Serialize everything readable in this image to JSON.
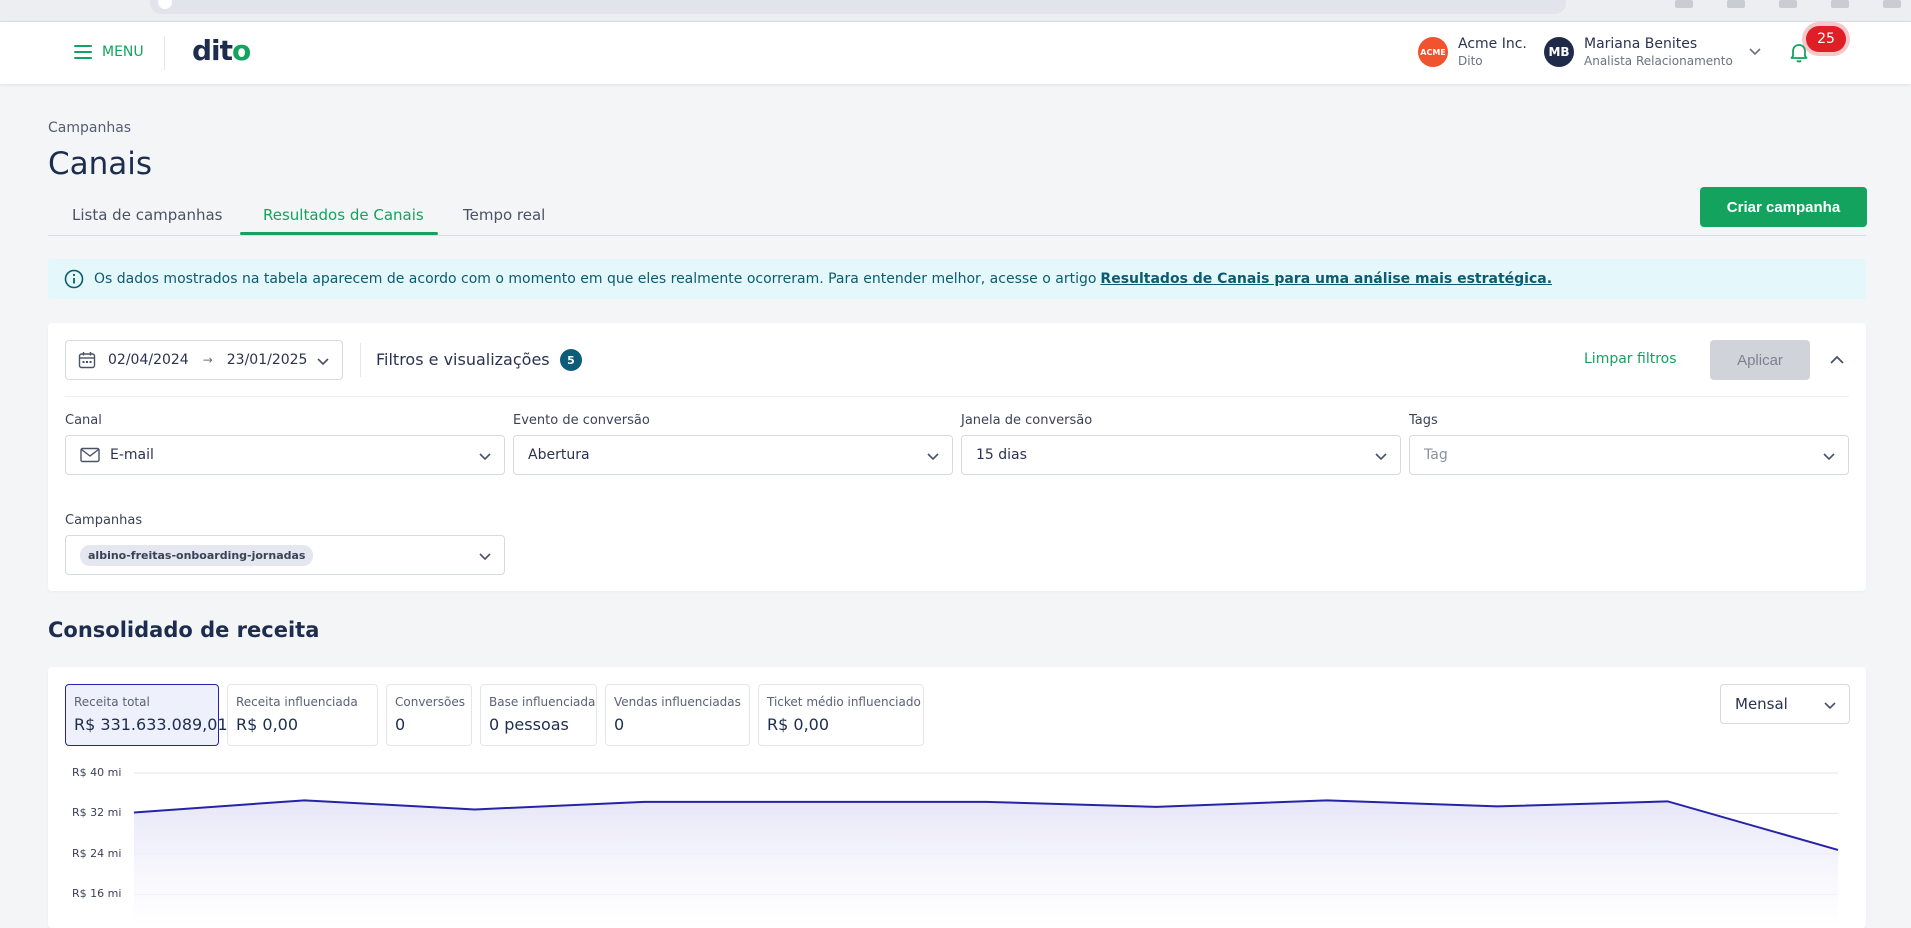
{
  "header": {
    "menu_label": "MENU",
    "logo": {
      "text": "dit",
      "suffix": "o"
    },
    "company": {
      "badge": "ACME",
      "name": "Acme Inc.",
      "sub": "Dito"
    },
    "user": {
      "initials": "MB",
      "name": "Mariana Benites",
      "role": "Analista Relacionamento"
    },
    "notifications": "25"
  },
  "page": {
    "breadcrumb": "Campanhas",
    "title": "Canais",
    "tabs": [
      {
        "label": "Lista de campanhas"
      },
      {
        "label": "Resultados de Canais",
        "active": true
      },
      {
        "label": "Tempo real"
      }
    ],
    "create_button": "Criar campanha"
  },
  "banner": {
    "text": "Os dados mostrados na tabela aparecem de acordo com o momento em que eles realmente ocorreram. Para entender melhor, acesse o artigo",
    "link": "Resultados de Canais para uma análise mais estratégica."
  },
  "filters": {
    "date_start": "02/04/2024",
    "date_end": "23/01/2025",
    "title": "Filtros e visualizações",
    "count": "5",
    "clear": "Limpar filtros",
    "apply": "Aplicar",
    "fields": {
      "canal": {
        "label": "Canal",
        "value": "E-mail"
      },
      "evento": {
        "label": "Evento de conversão",
        "value": "Abertura"
      },
      "janela": {
        "label": "Janela de conversão",
        "value": "15 dias"
      },
      "tags": {
        "label": "Tags",
        "placeholder": "Tag"
      },
      "campanhas": {
        "label": "Campanhas",
        "chip": "albino-freitas-onboarding-jornadas"
      }
    }
  },
  "revenue": {
    "title": "Consolidado de receita",
    "kpis": [
      {
        "label": "Receita total",
        "value": "R$ 331.633.089,01",
        "active": true
      },
      {
        "label": "Receita influenciada",
        "value": "R$ 0,00"
      },
      {
        "label": "Conversões",
        "value": "0"
      },
      {
        "label": "Base influenciada",
        "value": "0 pessoas"
      },
      {
        "label": "Vendas influenciadas",
        "value": "0"
      },
      {
        "label": "Ticket médio influenciado",
        "value": "R$ 0,00"
      }
    ],
    "period": "Mensal"
  },
  "colors": {
    "primary_green": "#13a35f",
    "series_line": "#2623a8",
    "series_fill": "#e7e6f8",
    "notification_red": "#e01e26",
    "banner_bg": "#e4f8fb"
  },
  "chart_data": {
    "type": "area",
    "y_unit": "R$ mi",
    "yticks": [
      "R$ 40 mi",
      "R$ 32 mi",
      "R$ 24 mi",
      "R$ 16 mi"
    ],
    "ytick_values": [
      40,
      32,
      24,
      16
    ],
    "ylim": [
      0,
      40
    ],
    "grid": true,
    "series": [
      {
        "values": [
          32.2,
          34.6,
          32.8,
          34.3,
          34.3,
          34.3,
          33.3,
          34.6,
          33.4,
          34.4,
          24.8
        ]
      }
    ]
  }
}
